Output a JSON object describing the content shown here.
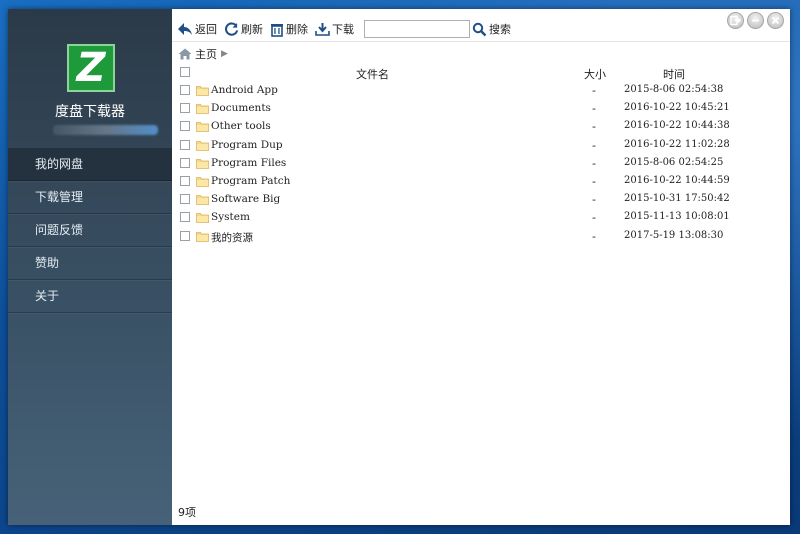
{
  "sidebar": {
    "logo_letter": "Z",
    "app_name": "度盘下载器",
    "items": [
      {
        "label": "我的网盘",
        "active": true
      },
      {
        "label": "下载管理",
        "active": false
      },
      {
        "label": "问题反馈",
        "active": false
      },
      {
        "label": "赞助",
        "active": false
      },
      {
        "label": "关于",
        "active": false
      }
    ]
  },
  "toolbar": {
    "back_label": "返回",
    "refresh_label": "刷新",
    "delete_label": "删除",
    "download_label": "下载",
    "search_placeholder": "",
    "search_label": "搜索"
  },
  "breadcrumb": {
    "home_label": "主页"
  },
  "table": {
    "columns": {
      "name": "文件名",
      "size": "大小",
      "time": "时间"
    },
    "rows": [
      {
        "name": "Android App",
        "size": "-",
        "time": "2015-8-06 02:54:38"
      },
      {
        "name": "Documents",
        "size": "-",
        "time": "2016-10-22 10:45:21"
      },
      {
        "name": "Other tools",
        "size": "-",
        "time": "2016-10-22 10:44:38"
      },
      {
        "name": "Program Dup",
        "size": "-",
        "time": "2016-10-22 11:02:28"
      },
      {
        "name": "Program Files",
        "size": "-",
        "time": "2015-8-06 02:54:25"
      },
      {
        "name": "Program Patch",
        "size": "-",
        "time": "2016-10-22 10:44:59"
      },
      {
        "name": "Software Big",
        "size": "-",
        "time": "2015-10-31 17:50:42"
      },
      {
        "name": "System",
        "size": "-",
        "time": "2015-11-13 10:08:01"
      },
      {
        "name": "我的资源",
        "size": "-",
        "time": "2017-5-19 13:08:30"
      }
    ]
  },
  "status": {
    "count_label": "9项"
  },
  "colors": {
    "sidebar": "#2b3a48",
    "logo": "#1f9a3b",
    "accent": "#1a5fa8"
  }
}
